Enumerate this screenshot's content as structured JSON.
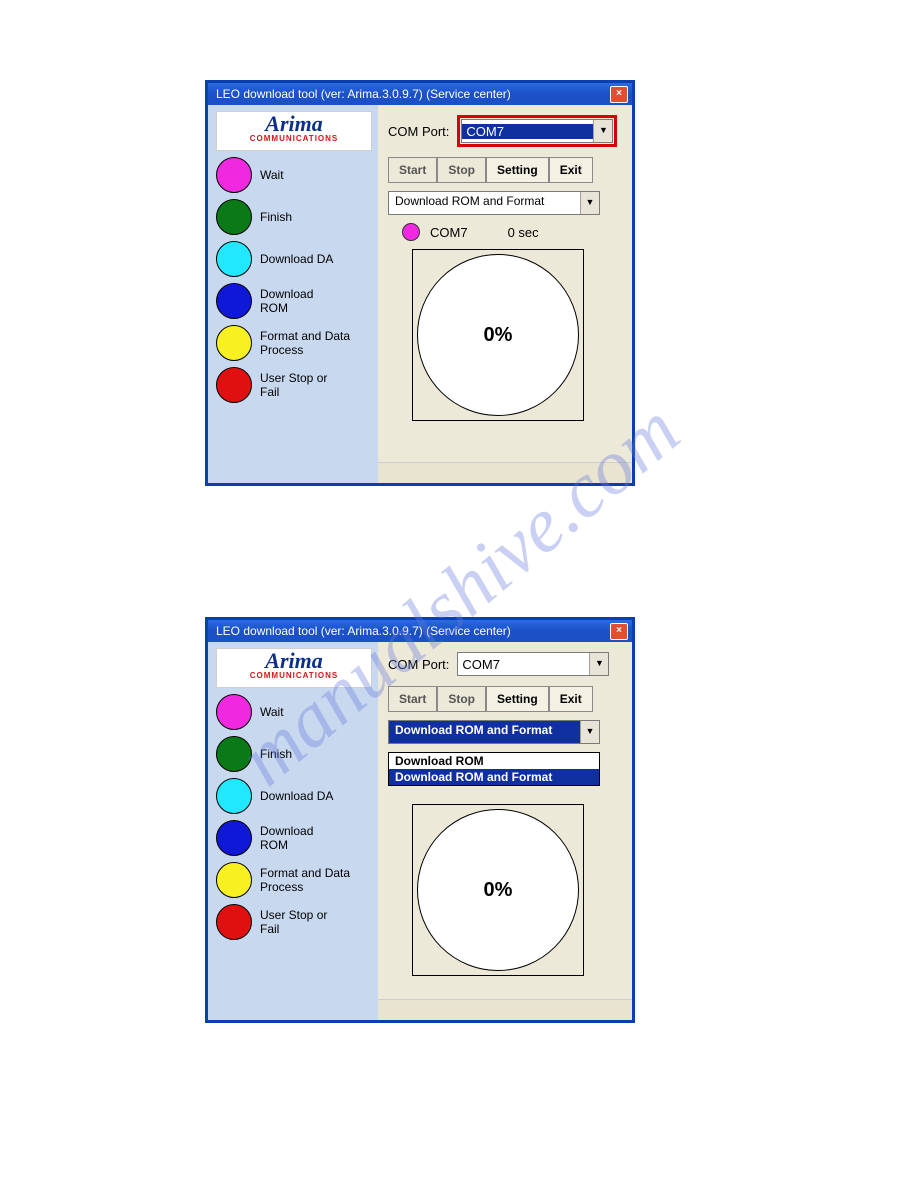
{
  "watermark": "manualshive.com",
  "window": {
    "title": "LEO download tool  (ver: Arima.3.0.9.7) (Service center)",
    "close_glyph": "×"
  },
  "logo": {
    "brand": "Arima",
    "sub": "COMMUNICATIONS"
  },
  "legend": [
    {
      "color": "#f028e0",
      "label": "Wait"
    },
    {
      "color": "#0a7a18",
      "label": "Finish"
    },
    {
      "color": "#22e8ff",
      "label": "Download DA"
    },
    {
      "color": "#1018d8",
      "label": "Download ROM"
    },
    {
      "color": "#f8f020",
      "label": "Format and Data Process"
    },
    {
      "color": "#e01010",
      "label": "User Stop or Fail"
    }
  ],
  "port": {
    "label": "COM Port:",
    "value": "COM7"
  },
  "buttons": {
    "start": "Start",
    "stop": "Stop",
    "setting": "Setting",
    "exit": "Exit"
  },
  "mode": {
    "value": "Download ROM and Format",
    "options": [
      "Download ROM",
      "Download ROM and Format"
    ],
    "selected_index": 1
  },
  "status": {
    "port": "COM7",
    "time": "0 sec"
  },
  "progress": {
    "text": "0%"
  }
}
